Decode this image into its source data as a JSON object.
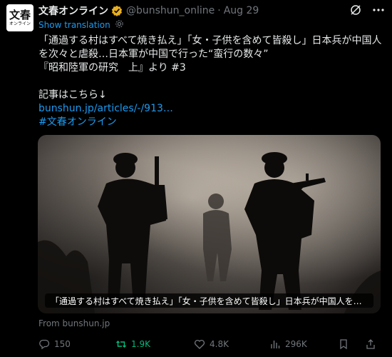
{
  "account": {
    "name": "文春オンライン",
    "handle": "@bunshun_online",
    "separator": "·",
    "date": "Aug 29",
    "avatar_big": "文春",
    "avatar_small": "オンライン"
  },
  "translation": {
    "label": "Show translation"
  },
  "post": {
    "lines": [
      "「通過する村はすべて焼き払え」「女・子供を含めて皆殺し」日本兵が中国人",
      "を次々と虐殺…日本軍が中国で行った“蛮行の数々”",
      "『昭和陸軍の研究　上』より #3"
    ],
    "read_more": "記事はこちら↓",
    "link": "bunshun.jp/articles/-/913…",
    "hashtag": "#文春オンライン"
  },
  "media": {
    "caption": "「通過する村はすべて焼き払え」「女・子供を含めて皆殺し」日本兵が中国人を…"
  },
  "source": {
    "label": "From bunshun.jp"
  },
  "stats": {
    "replies": "150",
    "reposts": "1.9K",
    "likes": "4.8K",
    "views": "296K"
  },
  "colors": {
    "accent": "#1d9bf0",
    "repost_active": "#00ba7c",
    "muted": "#71767b",
    "verified": "#e8b020"
  }
}
